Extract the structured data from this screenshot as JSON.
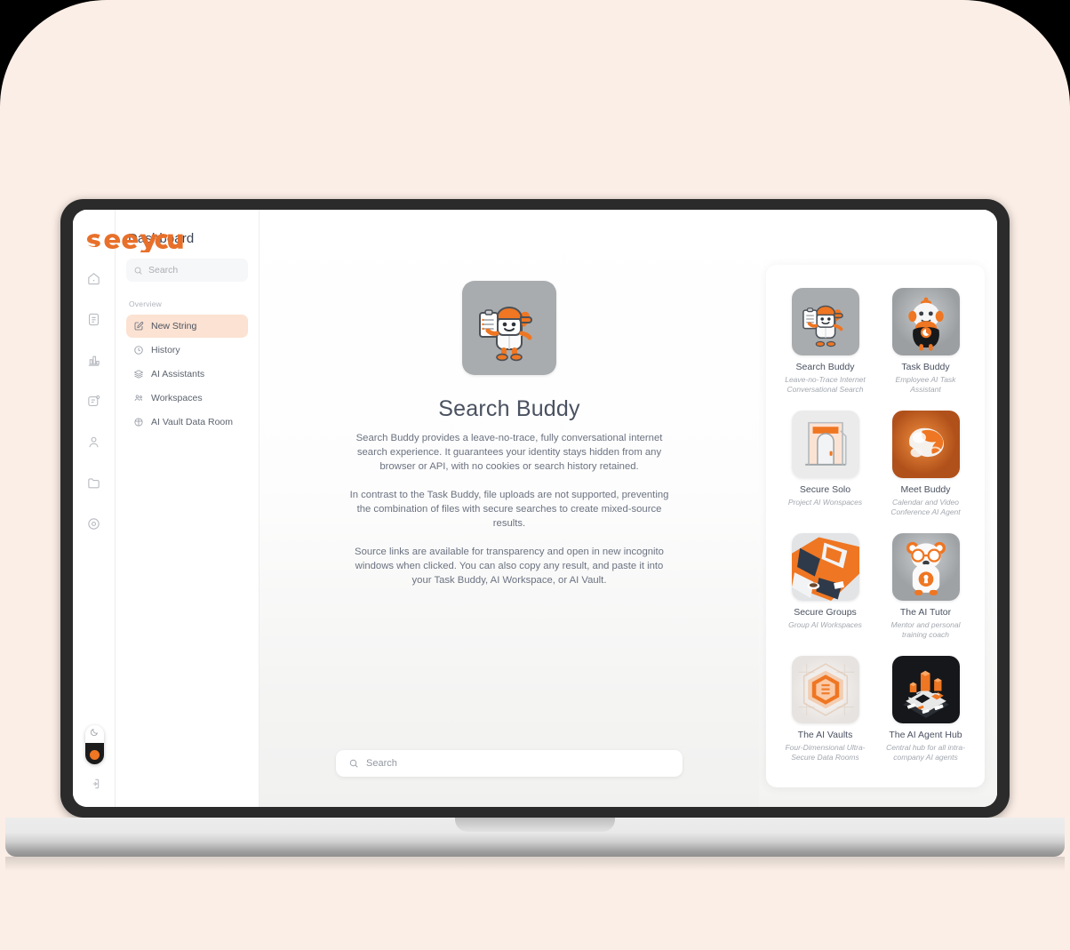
{
  "brand": {
    "logo_text": "seeyou",
    "accent_color": "#e8702a",
    "accent_soft": "#fbe2d2"
  },
  "rail": {
    "items": [
      {
        "name": "home-icon",
        "label": "Home"
      },
      {
        "name": "document-icon",
        "label": "Documents"
      },
      {
        "name": "analytics-icon",
        "label": "Analytics"
      },
      {
        "name": "notes-icon",
        "label": "Notes"
      },
      {
        "name": "profile-icon",
        "label": "Profile"
      },
      {
        "name": "folder-icon",
        "label": "Files"
      },
      {
        "name": "settings-icon",
        "label": "Settings"
      }
    ],
    "theme_toggle": {
      "name": "dark-mode-toggle",
      "state": "dark"
    },
    "logout": {
      "name": "logout-icon",
      "label": "Log out"
    }
  },
  "sidebar": {
    "title": "Dashboard",
    "search": {
      "placeholder": "Search",
      "value": ""
    },
    "group_label": "Overview",
    "items": [
      {
        "label": "New String",
        "icon": "edit-square-icon",
        "active": true
      },
      {
        "label": "History",
        "icon": "clock-icon",
        "active": false
      },
      {
        "label": "AI Assistants",
        "icon": "layers-icon",
        "active": false
      },
      {
        "label": "Workspaces",
        "icon": "people-icon",
        "active": false
      },
      {
        "label": "AI Vault Data Room",
        "icon": "globe-shield-icon",
        "active": false
      }
    ]
  },
  "main": {
    "hero_icon": "search-buddy-mascot",
    "title": "Search Buddy",
    "paragraphs": [
      "Search Buddy provides a leave-no-trace, fully conversational internet search experience. It guarantees your identity stays hidden from any browser or API, with no cookies or search history retained.",
      "In contrast to the Task Buddy, file uploads are not supported, preventing the combination of files with secure searches to create mixed-source results.",
      "Source links are available for transparency and open in new incognito windows when clicked. You can also copy any result, and paste it into your Task Buddy, AI Workspace, or AI Vault."
    ],
    "search": {
      "placeholder": "Search",
      "value": ""
    }
  },
  "agents": [
    {
      "name": "Search Buddy",
      "desc": "Leave-no-Trace Internet Conversational Search",
      "art": "search-buddy"
    },
    {
      "name": "Task Buddy",
      "desc": "Employee AI Task Assistant",
      "art": "task-buddy"
    },
    {
      "name": "Secure Solo",
      "desc": "Project AI Wonspaces",
      "art": "secure-solo"
    },
    {
      "name": "Meet Buddy",
      "desc": "Calendar and Video Conference AI Agent",
      "art": "meet-buddy"
    },
    {
      "name": "Secure Groups",
      "desc": "Group AI Workspaces",
      "art": "secure-groups"
    },
    {
      "name": "The AI Tutor",
      "desc": "Mentor and personal training coach",
      "art": "ai-tutor"
    },
    {
      "name": "The AI Vaults",
      "desc": "Four-Dimensional Ultra-Secure Data Rooms",
      "art": "ai-vaults"
    },
    {
      "name": "The AI Agent Hub",
      "desc": "Central hub for all intra-company AI agents",
      "art": "ai-agent-hub"
    }
  ]
}
